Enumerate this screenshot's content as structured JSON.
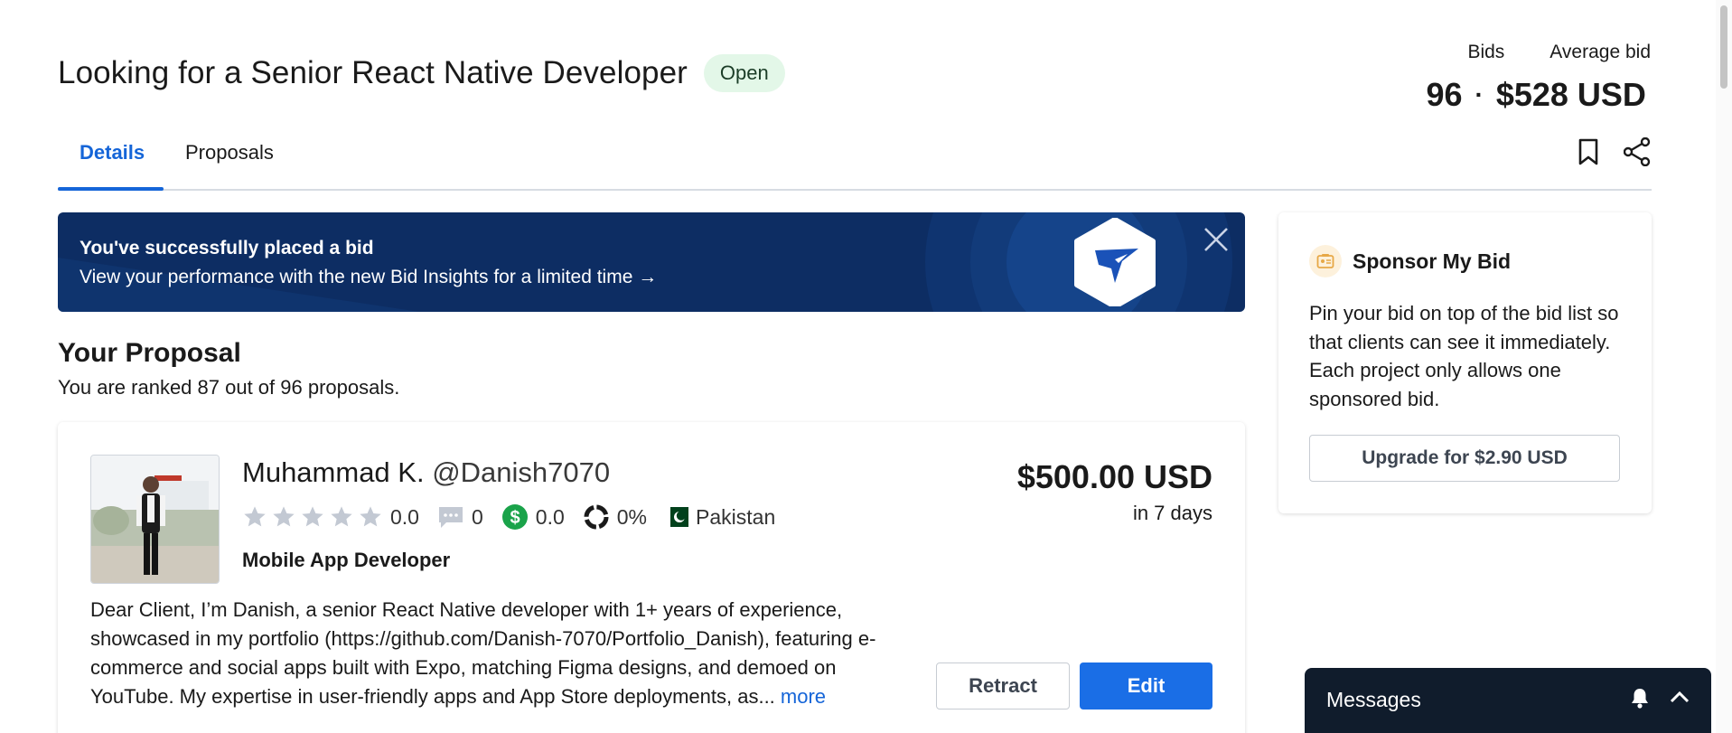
{
  "header": {
    "title": "Looking for a Senior React Native Developer",
    "status": "Open",
    "bids_label": "Bids",
    "avg_bid_label": "Average bid",
    "bids_count": "96",
    "separator": "·",
    "avg_bid_value": "$528 USD"
  },
  "tabs": [
    {
      "label": "Details",
      "active": true
    },
    {
      "label": "Proposals",
      "active": false
    }
  ],
  "toolbar": {
    "bookmark_icon": "bookmark-icon",
    "share_icon": "share-icon"
  },
  "banner": {
    "title": "You've successfully placed a bid",
    "subtitle": "View your performance with the new Bid Insights for a limited time →",
    "close_icon": "close-icon",
    "logo_icon": "freelancer-bird-logo"
  },
  "proposal": {
    "section_title": "Your Proposal",
    "rank_text": "You are ranked 87 out of 96 proposals.",
    "bidder_name": "Muhammad K.",
    "bidder_handle": "@Danish7070",
    "rating": "0.0",
    "stars_filled": 0,
    "reviews": "0",
    "earnings_score": "0.0",
    "completion": "0%",
    "country": "Pakistan",
    "role": "Mobile App Developer",
    "amount": "$500.00 USD",
    "duration": "in 7 days",
    "description": "Dear Client, I’m Danish, a senior React Native developer with 1+ years of experience, showcased in my portfolio (https://github.com/Danish-7070/Portfolio_Danish), featuring e-commerce and social apps built with Expo, matching Figma designs, and demoed on YouTube. My expertise in user-friendly apps and App Store deployments, as...",
    "more_label": "more",
    "retract_label": "Retract",
    "edit_label": "Edit"
  },
  "sponsor": {
    "title": "Sponsor My Bid",
    "description": "Pin your bid on top of the bid list so that clients can see it immediately. Each project only allows one sponsored bid.",
    "button_label": "Upgrade for $2.90 USD"
  },
  "messages": {
    "label": "Messages",
    "bell_icon": "bell-icon",
    "chevron_icon": "chevron-up-icon"
  },
  "colors": {
    "accent": "#1565d8",
    "banner_bg": "#0d2d63",
    "status_bg": "#e3f7e8",
    "earnings_green": "#1aa34a",
    "messages_bg": "#101c2c"
  }
}
